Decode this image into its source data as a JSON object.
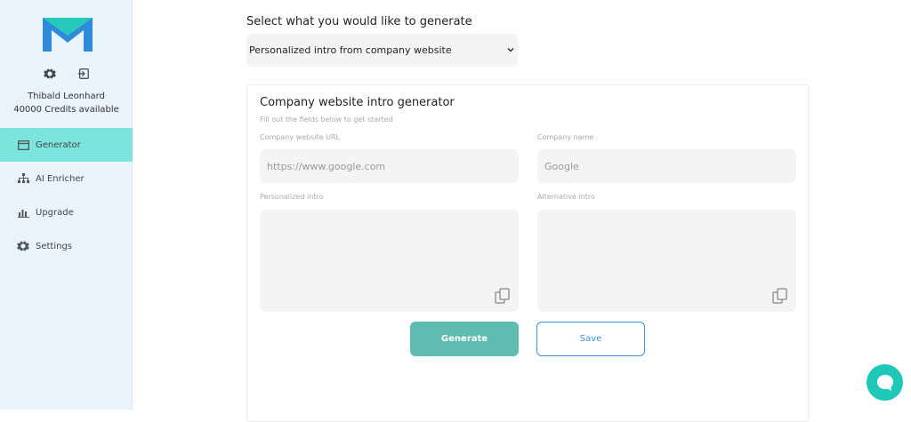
{
  "sidebar": {
    "logo_icon": "m-logo-icon",
    "icons": [
      "gear-icon",
      "logout-icon"
    ],
    "user_name": "Thibald Leonhard",
    "credits": "40000 Credits available",
    "items": [
      {
        "label": "Generator",
        "icon": "window-icon",
        "active": true
      },
      {
        "label": "AI Enricher",
        "icon": "sitemap-icon",
        "active": false
      },
      {
        "label": "Upgrade",
        "icon": "bar-chart-icon",
        "active": false
      },
      {
        "label": "Settings",
        "icon": "gear-icon",
        "active": false
      }
    ]
  },
  "main": {
    "prompt": "Select what you would like to generate",
    "select_value": "Personalized intro from company website"
  },
  "card": {
    "title": "Company website intro generator",
    "subtitle": "Fill out the fields below to get started",
    "url_label": "Company website URL",
    "url_placeholder": "https://www.google.com",
    "name_label": "Company name",
    "name_placeholder": "Google",
    "intro_label": "Personalized intro",
    "alt_label": "Alternative intro",
    "generate_label": "Generate",
    "save_label": "Save"
  },
  "colors": {
    "accent": "#7be4dc",
    "generate_bg": "#5fbcb0",
    "save_border": "#3b8fd6",
    "chat_bg": "#1ec7b8",
    "logo_blue": "#2f8bd9",
    "logo_teal": "#25c9bc"
  }
}
